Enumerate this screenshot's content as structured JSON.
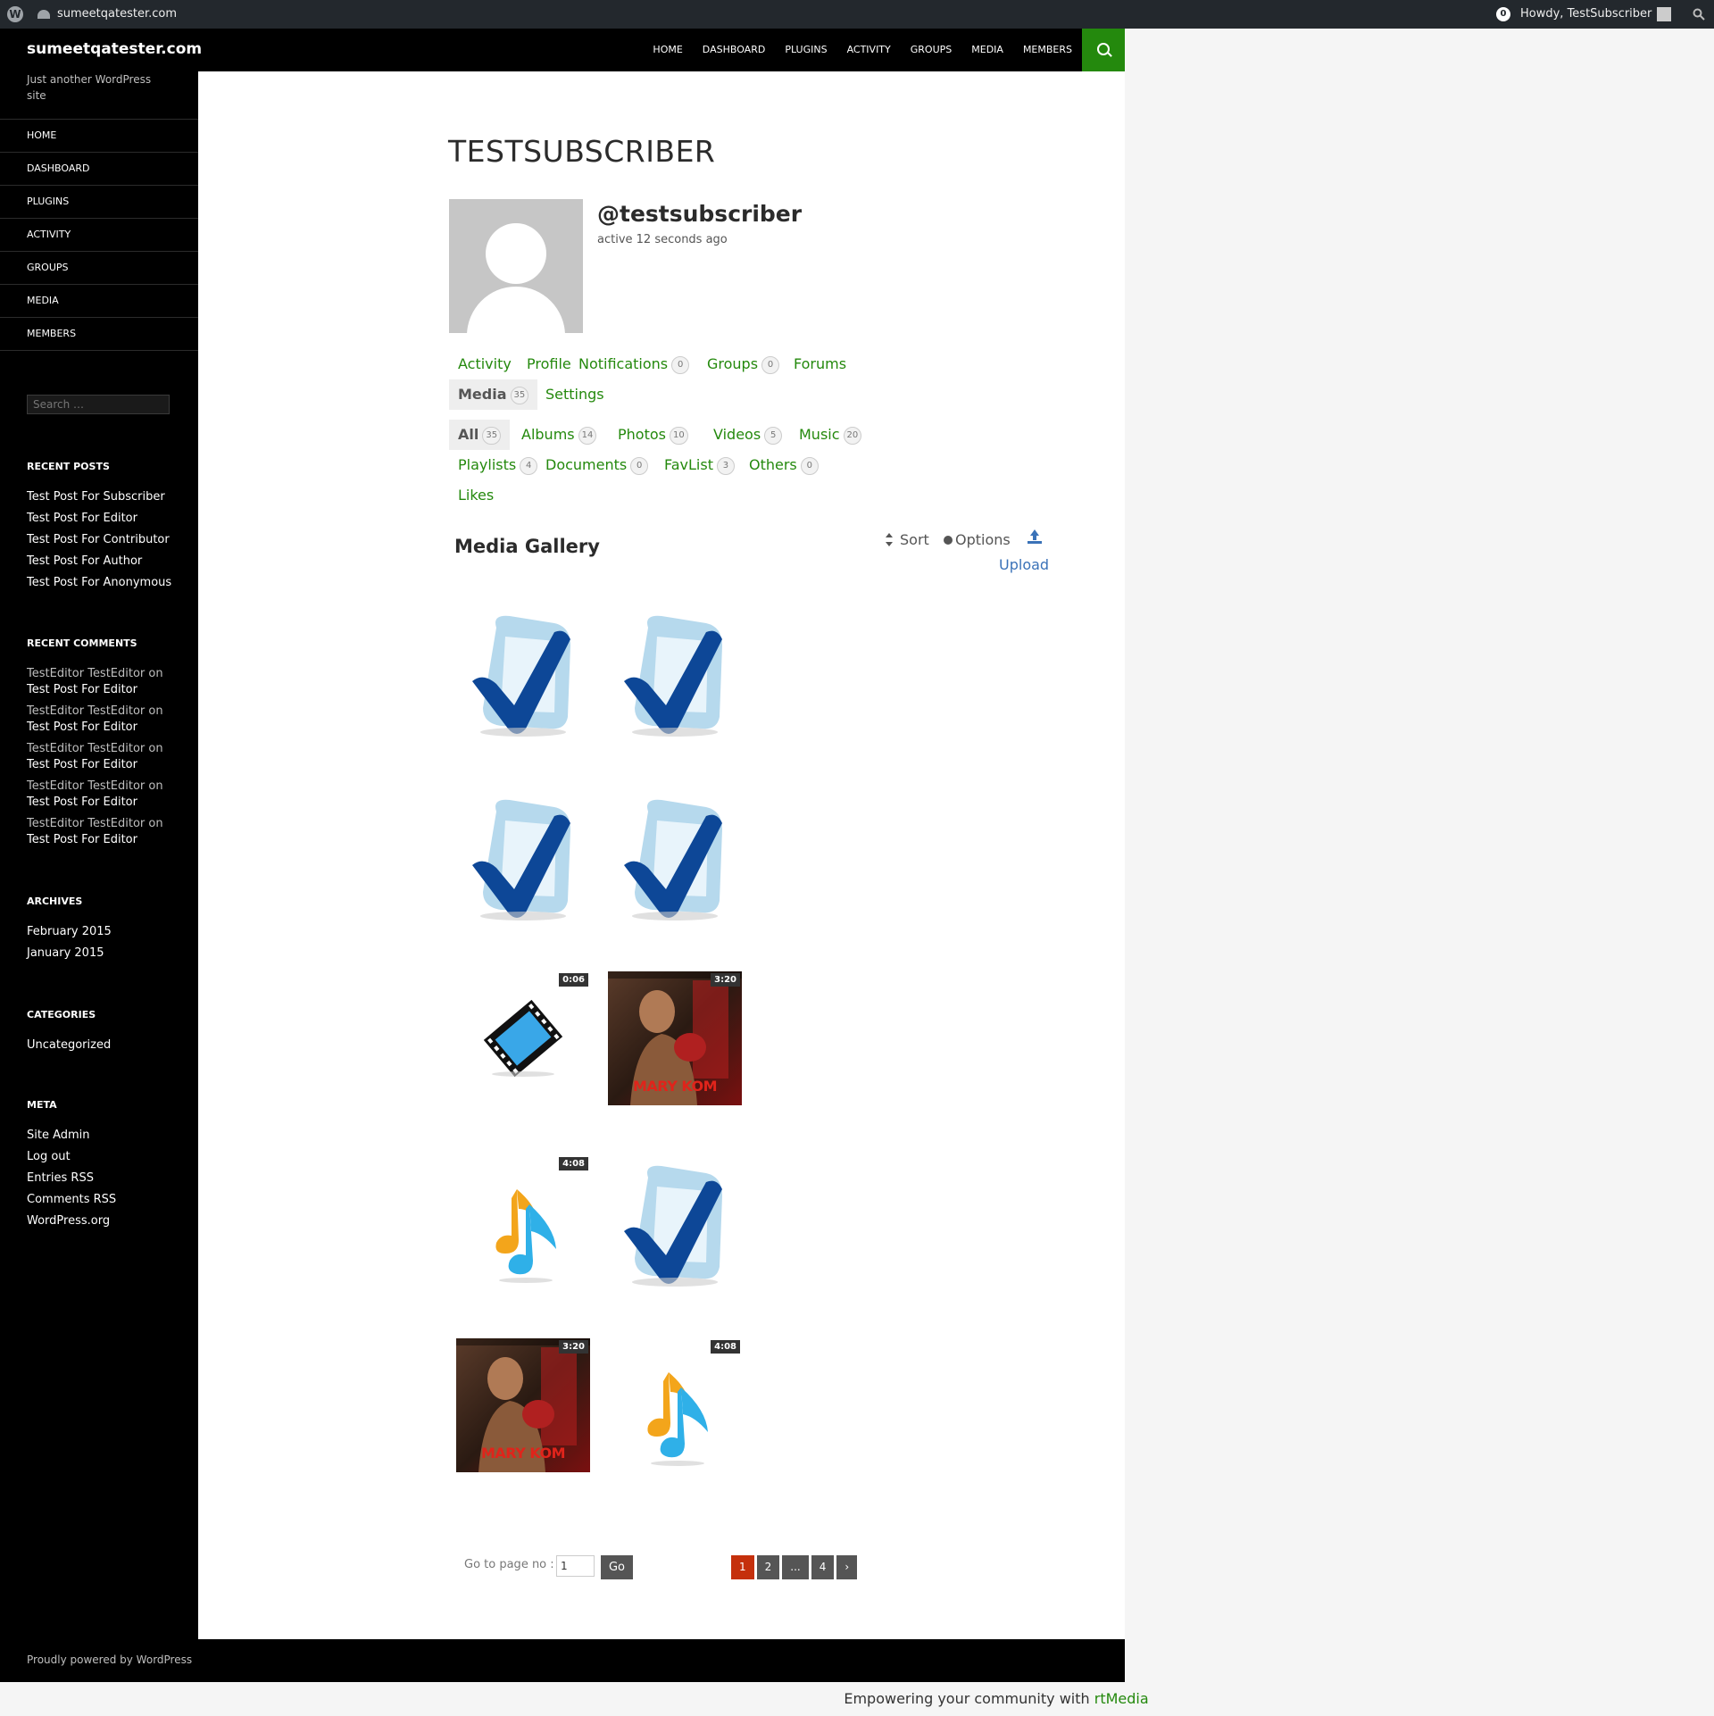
{
  "admin_bar": {
    "site_name": "sumeetqatester.com",
    "notifications": "0",
    "howdy": "Howdy, TestSubscriber"
  },
  "site": {
    "title": "sumeetqatester.com",
    "description": "Just another WordPress site"
  },
  "primary_nav": [
    "HOME",
    "DASHBOARD",
    "PLUGINS",
    "ACTIVITY",
    "GROUPS",
    "MEDIA",
    "MEMBERS"
  ],
  "side_nav": [
    "HOME",
    "DASHBOARD",
    "PLUGINS",
    "ACTIVITY",
    "GROUPS",
    "MEDIA",
    "MEMBERS"
  ],
  "sidebar": {
    "search_placeholder": "Search …",
    "recent_posts_title": "RECENT POSTS",
    "recent_posts": [
      "Test Post For Subscriber",
      "Test Post For Editor",
      "Test Post For Contributor",
      "Test Post For Author",
      "Test Post For Anonymous"
    ],
    "recent_comments_title": "RECENT COMMENTS",
    "recent_comments": [
      {
        "author": "TestEditor TestEditor",
        "on": "on",
        "post": "Test Post For Editor"
      },
      {
        "author": "TestEditor TestEditor",
        "on": "on",
        "post": "Test Post For Editor"
      },
      {
        "author": "TestEditor TestEditor",
        "on": "on",
        "post": "Test Post For Editor"
      },
      {
        "author": "TestEditor TestEditor",
        "on": "on",
        "post": "Test Post For Editor"
      },
      {
        "author": "TestEditor TestEditor",
        "on": "on",
        "post": "Test Post For Editor"
      }
    ],
    "archives_title": "ARCHIVES",
    "archives": [
      "February 2015",
      "January 2015"
    ],
    "categories_title": "CATEGORIES",
    "categories": [
      "Uncategorized"
    ],
    "meta_title": "META",
    "meta": [
      "Site Admin",
      "Log out",
      "Entries RSS",
      "Comments RSS",
      "WordPress.org"
    ]
  },
  "profile": {
    "page_title": "TESTSUBSCRIBER",
    "username": "@testsubscriber",
    "active": "active 12 seconds ago"
  },
  "profile_tabs": {
    "activity": "Activity",
    "profile": "Profile",
    "notifications": "Notifications",
    "notifications_count": "0",
    "groups": "Groups",
    "groups_count": "0",
    "forums": "Forums",
    "media": "Media",
    "media_count": "35",
    "settings": "Settings"
  },
  "media_tabs": {
    "all": "All",
    "all_count": "35",
    "albums": "Albums",
    "albums_count": "14",
    "photos": "Photos",
    "photos_count": "10",
    "videos": "Videos",
    "videos_count": "5",
    "music": "Music",
    "music_count": "20",
    "playlists": "Playlists",
    "playlists_count": "4",
    "documents": "Documents",
    "documents_count": "0",
    "favlist": "FavList",
    "favlist_count": "3",
    "others": "Others",
    "others_count": "0",
    "likes": "Likes"
  },
  "gallery": {
    "title": "Media Gallery",
    "sort": "Sort",
    "options": "Options",
    "upload": "Upload",
    "items": [
      {
        "kind": "photo-check-icon"
      },
      {
        "kind": "photo-check-icon"
      },
      {
        "kind": "photo-check-icon"
      },
      {
        "kind": "photo-check-icon"
      },
      {
        "kind": "video-film-icon",
        "duration": "0:06"
      },
      {
        "kind": "video-poster",
        "duration": "3:20",
        "poster_text": "MARY KOM"
      },
      {
        "kind": "music-note-icon",
        "duration": "4:08"
      },
      {
        "kind": "photo-check-icon"
      },
      {
        "kind": "video-poster",
        "duration": "3:20",
        "poster_text": "MARY KOM"
      },
      {
        "kind": "music-note-icon",
        "duration": "4:08"
      }
    ]
  },
  "pagination": {
    "goto_label": "Go to page no :",
    "goto_value": "1",
    "go_button": "Go",
    "pages": [
      "1",
      "2",
      "...",
      "4",
      "›"
    ],
    "current": "1"
  },
  "footer": {
    "powered": "Proudly powered by WordPress",
    "rtmedia_prefix": "Empowering your community with",
    "rtmedia_link": "rtMedia"
  }
}
